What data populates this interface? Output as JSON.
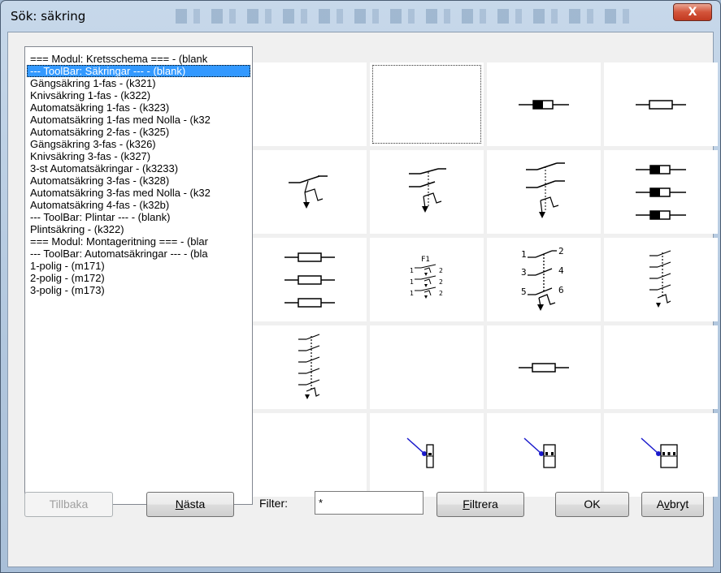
{
  "window": {
    "title": "Sök: säkring",
    "close_glyph": "X"
  },
  "list": {
    "items": [
      "=== Modul: Kretsschema === - (blank",
      "--- ToolBar: Säkringar --- - (blank)",
      "Gängsäkring 1-fas - (k321)",
      "Knivsäkring 1-fas - (k322)",
      "Automatsäkring 1-fas - (k323)",
      "Automatsäkring 1-fas med Nolla - (k32",
      "Automatsäkring 2-fas - (k325)",
      "Gängsäkring 3-fas - (k326)",
      "Knivsäkring 3-fas - (k327)",
      "3-st Automatsäkringar - (k3233)",
      "Automatsäkring 3-fas - (k328)",
      "Automatsäkring 3-fas med Nolla - (k32",
      "Automatsäkring 4-fas - (k32b)",
      "--- ToolBar: Plintar --- - (blank)",
      "Plintsäkring - (k322)",
      "=== Modul: Montageritning === - (blar",
      "--- ToolBar: Automatsäkringar --- - (bla",
      "1-polig - (m171)",
      "2-polig - (m172)",
      "3-polig - (m173)"
    ],
    "selected_index": 1
  },
  "symbols": {
    "f1_label": "F1",
    "pole_numbers": [
      "1",
      "2",
      "3",
      "4",
      "5",
      "6"
    ],
    "cells": [
      "blank",
      "blank-focused",
      "fuse-filled-icon",
      "fuse-outline-icon",
      "breaker-1pole-icon",
      "breaker-1pole-neutral-icon",
      "breaker-2pole-icon",
      "fuse-3pole-filled-icon",
      "fuse-3pole-outline-icon",
      "breakers-3x-icon",
      "breaker-3pole-icon",
      "breaker-3pole-neutral-icon",
      "breaker-4pole-icon",
      "blank",
      "terminal-fuse-icon",
      "blank",
      "mount-1pole-icon",
      "mount-2pole-icon",
      "mount-3pole-icon"
    ]
  },
  "buttons": {
    "back": "Tillbaka",
    "next_pre": "",
    "next_ul": "N",
    "next_post": "ästa",
    "filter_pre": "",
    "filter_ul": "F",
    "filter_post": "iltrera",
    "ok": "OK",
    "cancel_pre": "A",
    "cancel_ul": "v",
    "cancel_post": "bryt"
  },
  "filter": {
    "label": "Filter:",
    "value": "*"
  }
}
